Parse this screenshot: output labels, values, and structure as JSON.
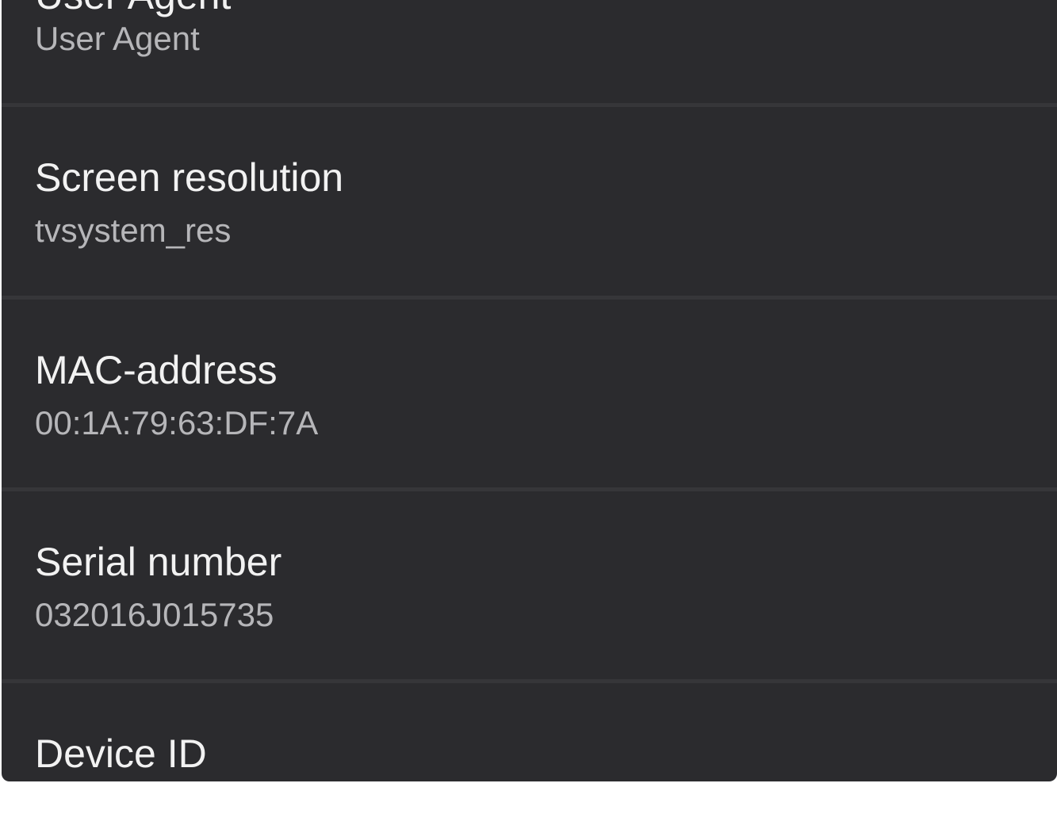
{
  "settings_list": {
    "items": [
      {
        "title": "User Agent",
        "value": "User Agent"
      },
      {
        "title": "Screen resolution",
        "value": "tvsystem_res"
      },
      {
        "title": "MAC-address",
        "value": "00:1A:79:63:DF:7A"
      },
      {
        "title": "Serial number",
        "value": "032016J015735"
      },
      {
        "title": "Device ID",
        "value": ""
      }
    ]
  },
  "colors": {
    "panel_background": "#2b2b2e",
    "divider": "#363639",
    "title_text": "#f2f2f2",
    "value_text": "#b6b6b9",
    "page_background": "#ffffff"
  }
}
